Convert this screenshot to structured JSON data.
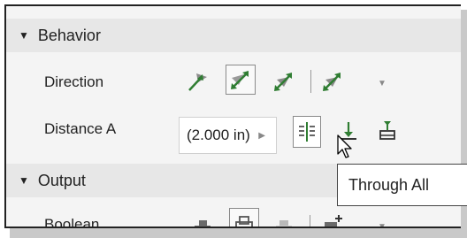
{
  "sections": {
    "behavior": {
      "title": "Behavior"
    },
    "output": {
      "title": "Output"
    }
  },
  "rows": {
    "direction": {
      "label": "Direction"
    },
    "distance": {
      "label": "Distance A",
      "value": "(2.000 in)"
    },
    "boolean": {
      "label": "Boolean"
    }
  },
  "tooltip": {
    "text": "Through All"
  },
  "icons": {
    "direction": [
      "direction-default-icon",
      "direction-flipped-icon",
      "direction-symmetric-icon",
      "direction-asymmetric-icon"
    ],
    "distance": [
      "through-all-icon",
      "to-icon",
      "between-icon"
    ],
    "boolean": [
      "join-icon",
      "cut-icon",
      "intersect-icon",
      "new-solid-icon"
    ]
  },
  "colors": {
    "accent": "#2f7d32",
    "icon_gray": "#7a7a7a",
    "header_bg": "#e7e7e7"
  }
}
